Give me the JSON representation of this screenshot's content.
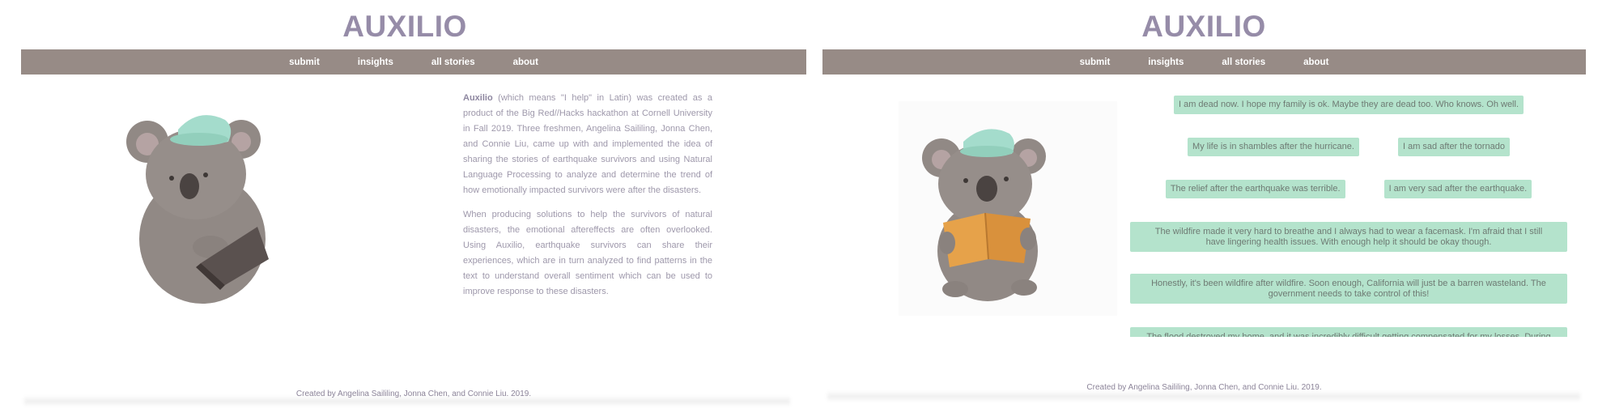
{
  "left_page": {
    "brand": "AUXILIO",
    "nav": [
      "submit",
      "insights",
      "all stories",
      "about"
    ],
    "about": {
      "bold_name": "Auxilio",
      "p1_rest": " (which means \"I help\" in Latin) was created as a product of the Big Red//Hacks hackathon at Cornell University in Fall 2019. Three freshmen, Angelina Saililing, Jonna Chen, and Connie Liu, came up with and implemented the idea of sharing the stories of earthquake survivors and using Natural Language Processing to analyze and determine the trend of how emotionally impacted survivors were after the disasters.",
      "p2": "When producing solutions to help the survivors of natural disasters, the emotional aftereffects are often overlooked. Using Auxilio, earthquake survivors can share their experiences, which are in turn analyzed to find patterns in the text to understand overall sentiment which can be used to improve response to these disasters."
    },
    "footer": "Created by Angelina Saililing, Jonna Chen, and Connie Liu. 2019."
  },
  "right_page": {
    "brand": "AUXILIO",
    "nav": [
      "submit",
      "insights",
      "all stories",
      "about"
    ],
    "stories": [
      "I am dead now. I hope my family is ok. Maybe they are dead too. Who knows. Oh well.",
      "My life is in shambles after the hurricane.",
      "I am sad after the tornado",
      "The relief after the earthquake was terrible.",
      "I am very sad after the earthquake.",
      "The wildfire made it very hard to breathe and I always had to wear a facemask. I'm afraid that I still have lingering health issues. With enough help it should be okay though.",
      "Honestly, it's been wildfire after wildfire. Soon enough, California will just be a barren wasteland. The government needs to take control of this!",
      "The flood destroyed my home, and it was incredibly difficult getting compensated for my losses. During the"
    ],
    "footer": "Created by Angelina Saililing, Jonna Chen, and Connie Liu. 2019."
  },
  "colors": {
    "brand": "#968ca8",
    "navbar": "#978b86",
    "story_bg": "#b4e3cc",
    "text": "#9e98ab"
  },
  "icons": {
    "left_illustration": "koala-with-laptop",
    "right_illustration": "koala-reading-book"
  }
}
